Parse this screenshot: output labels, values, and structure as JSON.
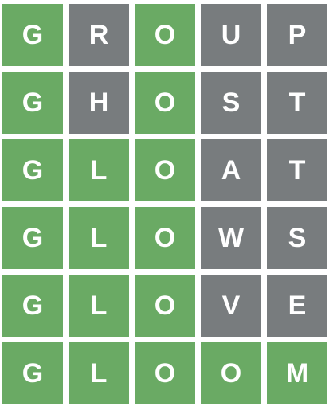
{
  "colors": {
    "correct": "#6aaa64",
    "absent": "#787c7e",
    "letter": "#ffffff"
  },
  "board": {
    "rows": [
      {
        "tiles": [
          {
            "letter": "G",
            "state": "correct"
          },
          {
            "letter": "R",
            "state": "absent"
          },
          {
            "letter": "O",
            "state": "correct"
          },
          {
            "letter": "U",
            "state": "absent"
          },
          {
            "letter": "P",
            "state": "absent"
          }
        ]
      },
      {
        "tiles": [
          {
            "letter": "G",
            "state": "correct"
          },
          {
            "letter": "H",
            "state": "absent"
          },
          {
            "letter": "O",
            "state": "correct"
          },
          {
            "letter": "S",
            "state": "absent"
          },
          {
            "letter": "T",
            "state": "absent"
          }
        ]
      },
      {
        "tiles": [
          {
            "letter": "G",
            "state": "correct"
          },
          {
            "letter": "L",
            "state": "correct"
          },
          {
            "letter": "O",
            "state": "correct"
          },
          {
            "letter": "A",
            "state": "absent"
          },
          {
            "letter": "T",
            "state": "absent"
          }
        ]
      },
      {
        "tiles": [
          {
            "letter": "G",
            "state": "correct"
          },
          {
            "letter": "L",
            "state": "correct"
          },
          {
            "letter": "O",
            "state": "correct"
          },
          {
            "letter": "W",
            "state": "absent"
          },
          {
            "letter": "S",
            "state": "absent"
          }
        ]
      },
      {
        "tiles": [
          {
            "letter": "G",
            "state": "correct"
          },
          {
            "letter": "L",
            "state": "correct"
          },
          {
            "letter": "O",
            "state": "correct"
          },
          {
            "letter": "V",
            "state": "absent"
          },
          {
            "letter": "E",
            "state": "absent"
          }
        ]
      },
      {
        "tiles": [
          {
            "letter": "G",
            "state": "correct"
          },
          {
            "letter": "L",
            "state": "correct"
          },
          {
            "letter": "O",
            "state": "correct"
          },
          {
            "letter": "O",
            "state": "correct"
          },
          {
            "letter": "M",
            "state": "correct"
          }
        ]
      }
    ]
  }
}
